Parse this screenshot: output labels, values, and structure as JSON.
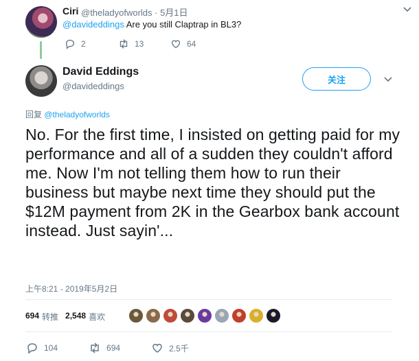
{
  "reply_tweet": {
    "name": "Ciri",
    "handle": "@theladyofworlds · 5月1日",
    "mention": "@davideddings",
    "text": " Are you still Claptrap in BL3?",
    "replies": "2",
    "retweets": "13",
    "likes": "64"
  },
  "main_tweet": {
    "name": "David Eddings",
    "handle": "@davideddings",
    "follow_label": "关注",
    "reply_prefix": "回复 ",
    "reply_mention": "@theladyofworlds",
    "text": "No. For the first time, I insisted on getting paid for my performance and all of a sudden they couldn't afford me. Now I'm not telling them how to run their business but maybe next time they should put the $12M payment from 2K in the Gearbox bank account instead. Just sayin'...",
    "timestamp": "上午8:21 - 2019年5月2日",
    "retweet_count": "694",
    "retweet_label": "转推",
    "like_count": "2,548",
    "like_label": "喜欢",
    "replies": "104",
    "retweets": "694",
    "likes": "2.5千"
  },
  "liker_colors": [
    "#6b5a3a",
    "#8a6a4a",
    "#c04a3a",
    "#5a4a3a",
    "#6a3aa0",
    "#9aa6b4",
    "#c0402a",
    "#d8b02a",
    "#1a1a2a"
  ],
  "colors": {
    "accent": "#1da1f2",
    "secondary_text": "#657786",
    "thread_line": "#8ecb96"
  }
}
